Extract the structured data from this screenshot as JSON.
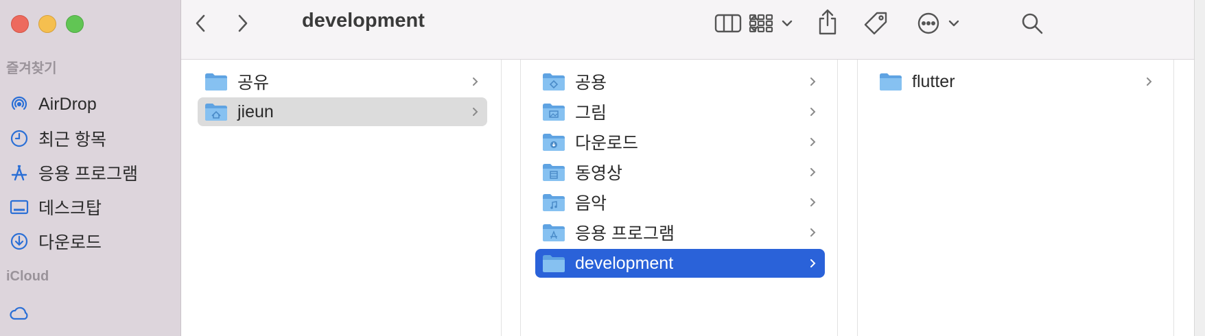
{
  "window": {
    "title": "development"
  },
  "sidebar": {
    "sections": [
      {
        "label": "즐겨찾기"
      },
      {
        "label": "iCloud"
      }
    ],
    "items": [
      {
        "label": "AirDrop",
        "icon": "airdrop-icon"
      },
      {
        "label": "최근 항목",
        "icon": "clock-icon"
      },
      {
        "label": "응용 프로그램",
        "icon": "applications-icon"
      },
      {
        "label": "데스크탑",
        "icon": "desktop-icon"
      },
      {
        "label": "다운로드",
        "icon": "download-icon"
      }
    ]
  },
  "toolbar": {
    "back": "chevron-left-icon",
    "forward": "chevron-right-icon",
    "view_mode": "column-view-icon",
    "group": "group-grid-icon",
    "share": "share-icon",
    "tag": "tag-icon",
    "more": "more-icon",
    "search": "search-icon"
  },
  "columns": [
    {
      "items": [
        {
          "name": "공유",
          "badge": "plain",
          "selected": "none"
        },
        {
          "name": "jieun",
          "badge": "home",
          "selected": "inactive"
        }
      ]
    },
    {
      "items": [
        {
          "name": "공용",
          "badge": "public",
          "selected": "none"
        },
        {
          "name": "그림",
          "badge": "pictures",
          "selected": "none"
        },
        {
          "name": "다운로드",
          "badge": "downloads",
          "selected": "none"
        },
        {
          "name": "동영상",
          "badge": "movies",
          "selected": "none"
        },
        {
          "name": "음악",
          "badge": "music",
          "selected": "none"
        },
        {
          "name": "응용 프로그램",
          "badge": "apps",
          "selected": "none"
        },
        {
          "name": "development",
          "badge": "plain",
          "selected": "active"
        }
      ]
    },
    {
      "items": [
        {
          "name": "flutter",
          "badge": "plain",
          "selected": "none"
        }
      ]
    }
  ],
  "colors": {
    "sidebar_bg": "#ddd5dc",
    "accent": "#2a62d9",
    "folder": "#7fb8ec",
    "sidebar_icon": "#2a6fd6"
  }
}
